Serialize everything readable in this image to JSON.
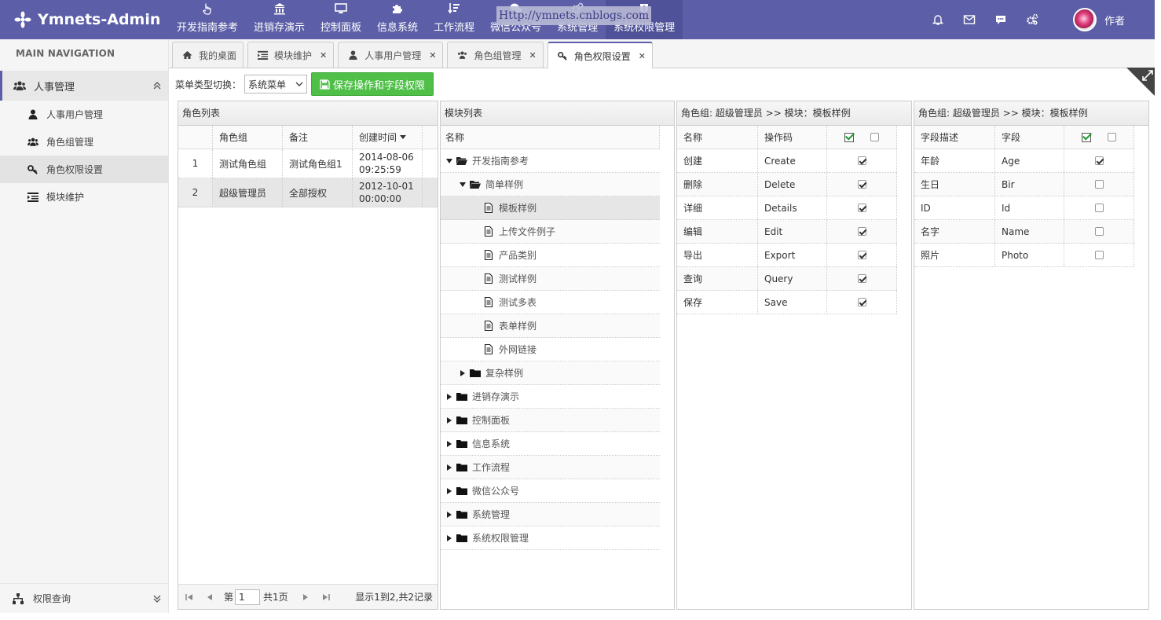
{
  "app": {
    "brand": "Ymnets-Admin",
    "watermark": "Http://ymnets.cnblogs.com",
    "author": "作者"
  },
  "topnav": [
    {
      "label": "开发指南参考",
      "icon": "hand-pointer-icon"
    },
    {
      "label": "进销存演示",
      "icon": "bank-icon"
    },
    {
      "label": "控制面板",
      "icon": "monitor-icon"
    },
    {
      "label": "信息系统",
      "icon": "puzzle-icon"
    },
    {
      "label": "工作流程",
      "icon": "sort-icon"
    },
    {
      "label": "微信公众号",
      "icon": "wechat-icon"
    },
    {
      "label": "系统管理",
      "icon": "gears-icon"
    },
    {
      "label": "系统权限管理",
      "icon": "shield-icon",
      "active": true
    }
  ],
  "sidebar": {
    "title": "MAIN NAVIGATION",
    "group": "人事管理",
    "items": [
      {
        "label": "人事用户管理",
        "icon": "user-icon"
      },
      {
        "label": "角色组管理",
        "icon": "users-icon"
      },
      {
        "label": "角色权限设置",
        "icon": "key-icon",
        "active": true
      },
      {
        "label": "模块维护",
        "icon": "indent-icon"
      }
    ],
    "bottom": "权限查询"
  },
  "tabs": [
    {
      "label": "我的桌面",
      "icon": "home-icon",
      "closable": false
    },
    {
      "label": "模块维护",
      "icon": "indent-icon",
      "closable": true
    },
    {
      "label": "人事用户管理",
      "icon": "user-icon",
      "closable": true
    },
    {
      "label": "角色组管理",
      "icon": "users-icon",
      "closable": true
    },
    {
      "label": "角色权限设置",
      "icon": "key-icon",
      "closable": true,
      "active": true
    }
  ],
  "toolbar": {
    "switch_label": "菜单类型切换：",
    "select_value": "系统菜单",
    "save_label": "保存操作和字段权限"
  },
  "roles": {
    "title": "角色列表",
    "columns": [
      "角色组",
      "备注",
      "创建时间"
    ],
    "rows": [
      {
        "no": "1",
        "group": "测试角色组",
        "note": "测试角色组1",
        "date": "2014-08-06",
        "time": "09:25:59"
      },
      {
        "no": "2",
        "group": "超级管理员",
        "note": "全部授权",
        "date": "2012-10-01",
        "time": "00:00:00"
      }
    ],
    "pager": {
      "page_prefix": "第",
      "page": "1",
      "total": "共1页",
      "info": "显示1到2,共2记录"
    }
  },
  "modules": {
    "title": "模块列表",
    "column": "名称",
    "tree": [
      {
        "label": "开发指南参考",
        "level": 0,
        "type": "open"
      },
      {
        "label": "简单样例",
        "level": 1,
        "type": "open"
      },
      {
        "label": "模板样例",
        "level": 2,
        "type": "leaf",
        "selected": true
      },
      {
        "label": "上传文件例子",
        "level": 2,
        "type": "leaf"
      },
      {
        "label": "产品类别",
        "level": 2,
        "type": "leaf"
      },
      {
        "label": "测试样例",
        "level": 2,
        "type": "leaf"
      },
      {
        "label": "测试多表",
        "level": 2,
        "type": "leaf"
      },
      {
        "label": "表单样例",
        "level": 2,
        "type": "leaf"
      },
      {
        "label": "外网链接",
        "level": 2,
        "type": "leaf"
      },
      {
        "label": "复杂样例",
        "level": 1,
        "type": "closed"
      },
      {
        "label": "进销存演示",
        "level": 0,
        "type": "closed"
      },
      {
        "label": "控制面板",
        "level": 0,
        "type": "closed"
      },
      {
        "label": "信息系统",
        "level": 0,
        "type": "closed"
      },
      {
        "label": "工作流程",
        "level": 0,
        "type": "closed"
      },
      {
        "label": "微信公众号",
        "level": 0,
        "type": "closed"
      },
      {
        "label": "系统管理",
        "level": 0,
        "type": "closed"
      },
      {
        "label": "系统权限管理",
        "level": 0,
        "type": "closed"
      }
    ]
  },
  "operations": {
    "title": "角色组: 超级管理员 >> 模块：模板样例",
    "columns": [
      "名称",
      "操作码"
    ],
    "rows": [
      {
        "name": "创建",
        "code": "Create",
        "checked": true
      },
      {
        "name": "删除",
        "code": "Delete",
        "checked": true
      },
      {
        "name": "详细",
        "code": "Details",
        "checked": true
      },
      {
        "name": "编辑",
        "code": "Edit",
        "checked": true
      },
      {
        "name": "导出",
        "code": "Export",
        "checked": true
      },
      {
        "name": "查询",
        "code": "Query",
        "checked": true
      },
      {
        "name": "保存",
        "code": "Save",
        "checked": true
      }
    ]
  },
  "fields": {
    "title": "角色组: 超级管理员 >> 模块：模板样例",
    "columns": [
      "字段描述",
      "字段"
    ],
    "rows": [
      {
        "desc": "年龄",
        "field": "Age",
        "checked": true
      },
      {
        "desc": "生日",
        "field": "Bir",
        "checked": false
      },
      {
        "desc": "ID",
        "field": "Id",
        "checked": false
      },
      {
        "desc": "名字",
        "field": "Name",
        "checked": false
      },
      {
        "desc": "照片",
        "field": "Photo",
        "checked": false
      }
    ]
  },
  "colors": {
    "brand": "#5c5fa7",
    "save_button": "#4fbf48"
  }
}
